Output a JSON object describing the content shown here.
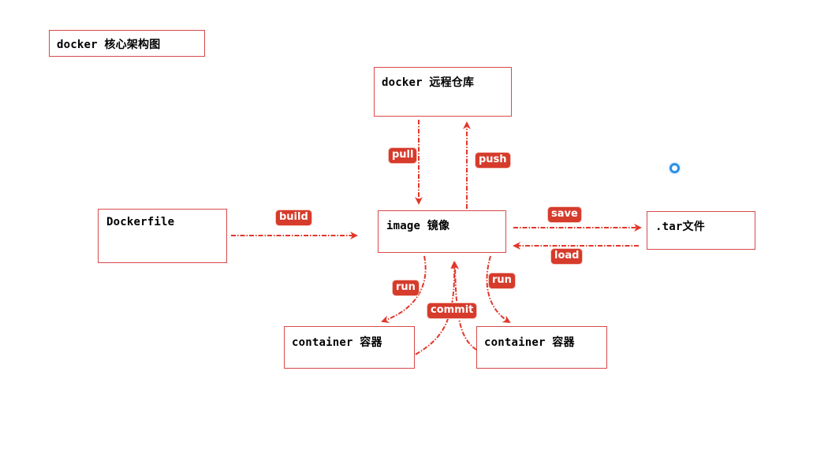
{
  "title": "docker 核心架构图",
  "nodes": {
    "registry": "docker 远程仓库",
    "dockerfile": "Dockerfile",
    "image": "image 镜像",
    "tar": ".tar文件",
    "container_left": "container 容器",
    "container_right": "container 容器"
  },
  "edges": {
    "pull": "pull",
    "push": "push",
    "build": "build",
    "save": "save",
    "load": "load",
    "run_left": "run",
    "commit": "commit",
    "run_right": "run"
  },
  "colors": {
    "box_border": "#d8494a",
    "arrow": "#e2372b",
    "label_bg": "#d63b2b",
    "cursor_ring": "#2d8fe6"
  },
  "icons": {
    "cursor": "cursor-ring-icon"
  }
}
